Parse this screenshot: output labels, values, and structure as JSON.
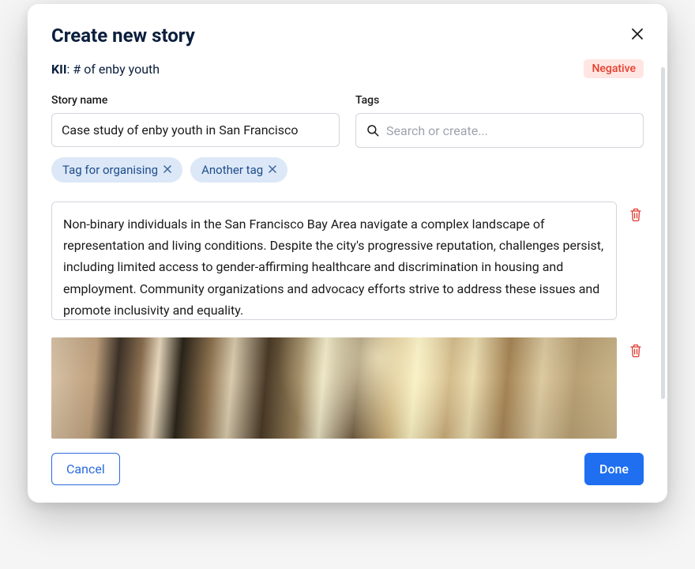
{
  "header": {
    "title": "Create new story"
  },
  "subheader": {
    "kii_label": "KII",
    "kii_value": "# of enby youth",
    "badge": "Negative"
  },
  "form": {
    "story_name_label": "Story name",
    "story_name_value": "Case study of enby youth in San Francisco",
    "tags_label": "Tags",
    "tags_placeholder": "Search or create..."
  },
  "tags": [
    {
      "label": "Tag for organising"
    },
    {
      "label": "Another tag"
    }
  ],
  "body": {
    "text": "Non-binary individuals in the San Francisco Bay Area navigate a complex landscape of representation and living conditions. Despite the city's progressive reputation, challenges persist, including limited access to gender-affirming healthcare and discrimination in housing and employment. Community organizations and advocacy efforts strive to address these issues and promote inclusivity and equality."
  },
  "footer": {
    "cancel": "Cancel",
    "done": "Done"
  },
  "colors": {
    "accent": "#1f6ff0",
    "negative_bg": "#ffe6e3",
    "negative_fg": "#e63e2b",
    "tag_bg": "#dce8f7",
    "tag_fg": "#1f4d8c"
  }
}
